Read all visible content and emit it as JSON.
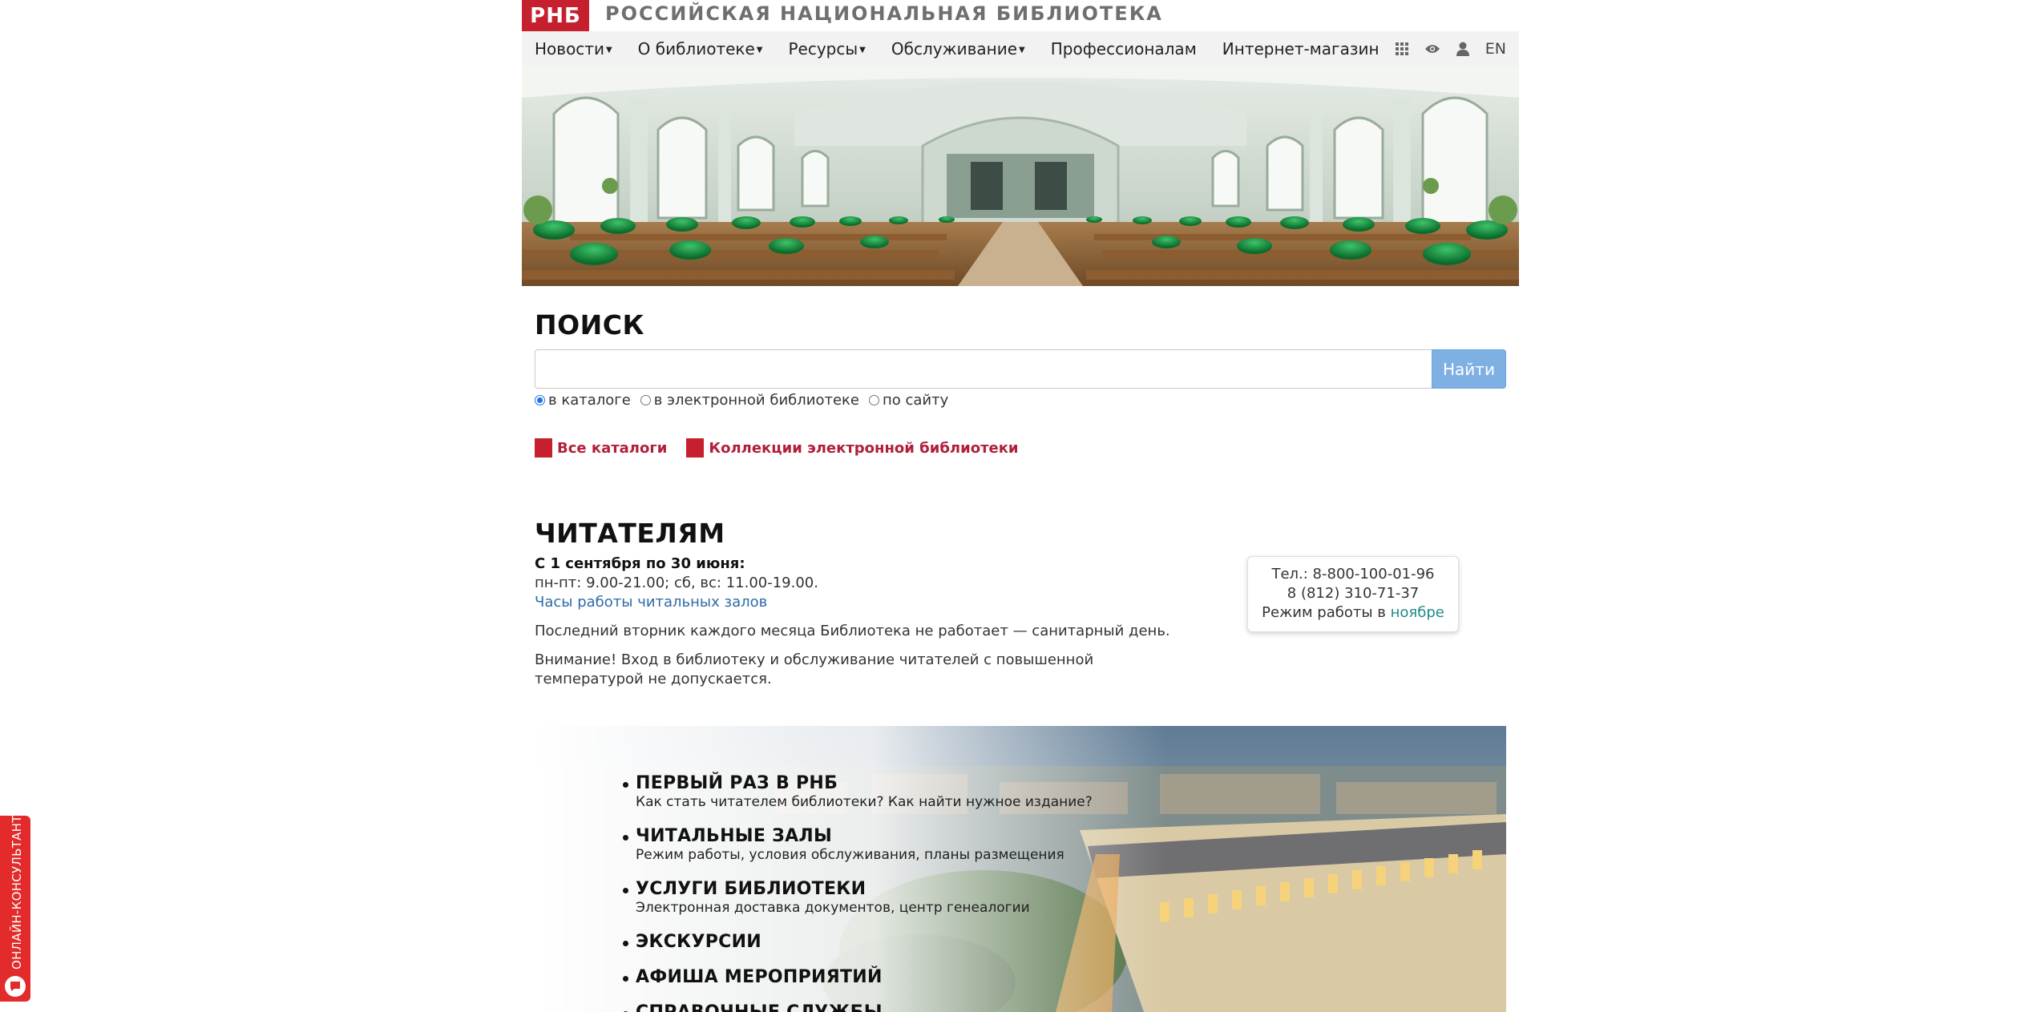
{
  "header": {
    "logo": "РНБ",
    "site_title": "РОССИЙСКАЯ НАЦИОНАЛЬНАЯ БИБЛИОТЕКА"
  },
  "nav": {
    "items": [
      {
        "label": "Новости",
        "dropdown": true
      },
      {
        "label": "О библиотеке",
        "dropdown": true
      },
      {
        "label": "Ресурсы",
        "dropdown": true
      },
      {
        "label": "Обслуживание",
        "dropdown": true
      },
      {
        "label": "Профессионалам",
        "dropdown": false
      },
      {
        "label": "Интернет-магазин",
        "dropdown": false
      }
    ],
    "icons": [
      "grid-icon",
      "eye-icon",
      "user-icon"
    ],
    "lang": "EN"
  },
  "search": {
    "title": "ПОИСК",
    "value": "",
    "button": "Найти",
    "options": [
      {
        "label": "в каталоге",
        "selected": true
      },
      {
        "label": "в электронной библиотеке",
        "selected": false
      },
      {
        "label": "по сайту",
        "selected": false
      }
    ],
    "links": [
      "Все каталоги",
      "Коллекции электронной библиотеки"
    ]
  },
  "readers": {
    "title": "ЧИТАТЕЛЯМ",
    "period": "С 1 сентября по 30 июня:",
    "hours": "пн-пт: 9.00-21.00; сб, вс: 11.00-19.00.",
    "hours_link": "Часы работы читальных залов",
    "note1": "Последний вторник каждого месяца Библиотека не работает — санитарный день.",
    "note2": "Внимание! Вход в библиотеку и обслуживание читателей с повышенной температурой не допускается.",
    "contact": {
      "phone1": "Тел.: 8-800-100-01-96",
      "phone2": "8 (812) 310-71-37",
      "schedule_prefix": "Режим работы в ",
      "schedule_month": "ноябре"
    }
  },
  "promo": {
    "items": [
      {
        "title": "ПЕРВЫЙ РАЗ В РНБ",
        "subtitle": "Как стать читателем библиотеки? Как найти нужное издание?"
      },
      {
        "title": "ЧИТАЛЬНЫЕ ЗАЛЫ",
        "subtitle": "Режим работы, условия обслуживания, планы размещения"
      },
      {
        "title": "УСЛУГИ БИБЛИОТЕКИ",
        "subtitle": "Электронная доставка документов, центр генеалогии"
      },
      {
        "title": "ЭКСКУРСИИ",
        "subtitle": ""
      },
      {
        "title": "АФИША МЕРОПРИЯТИЙ",
        "subtitle": ""
      },
      {
        "title": "СПРАВОЧНЫЕ СЛУЖБЫ",
        "subtitle": ""
      }
    ]
  },
  "consultant": {
    "label": "ОНЛАЙН-КОНСУЛЬТАНТ"
  },
  "colors": {
    "brand_red": "#c6202f",
    "link_red": "#b01f3a",
    "search_button": "#7fb0e3",
    "link_blue": "#2f6aa7",
    "teal": "#1e8a8a"
  }
}
